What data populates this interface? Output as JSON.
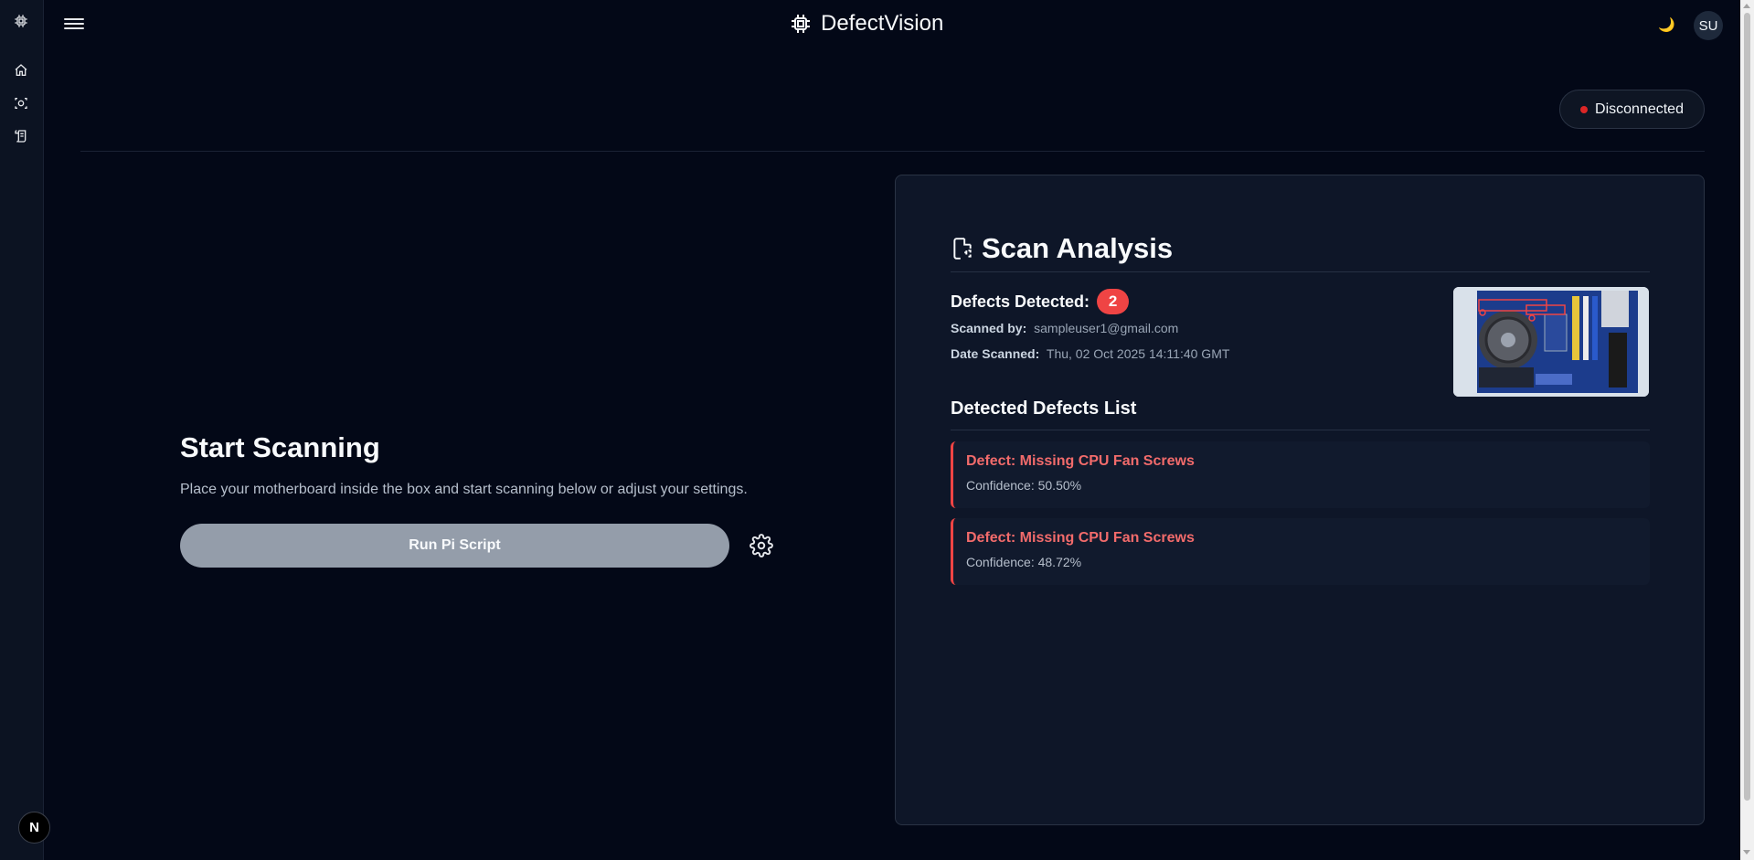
{
  "app": {
    "title": "DefectVision",
    "avatar_initials": "SU",
    "theme_icon": "moon-icon"
  },
  "sidebar": {
    "items": [
      {
        "name": "logo",
        "icon": "chip-icon"
      },
      {
        "name": "home",
        "icon": "home-icon"
      },
      {
        "name": "scan",
        "icon": "scan-icon"
      },
      {
        "name": "logs",
        "icon": "scroll-icon"
      }
    ],
    "footer_badge": "N"
  },
  "connection": {
    "status": "Disconnected",
    "color": "#dc2626"
  },
  "scanner": {
    "title": "Start Scanning",
    "description": "Place your motherboard inside the box and start scanning below or adjust your settings.",
    "run_label": "Run Pi Script"
  },
  "analysis": {
    "title": "Scan Analysis",
    "defects_label": "Defects Detected:",
    "defects_count": "2",
    "scanned_by_label": "Scanned by:",
    "scanned_by": "sampleuser1@gmail.com",
    "date_label": "Date Scanned:",
    "date": "Thu, 02 Oct 2025 14:11:40 GMT",
    "list_title": "Detected Defects List",
    "defects": [
      {
        "name": "Defect: Missing CPU Fan Screws",
        "confidence": "Confidence: 50.50%"
      },
      {
        "name": "Defect: Missing CPU Fan Screws",
        "confidence": "Confidence: 48.72%"
      }
    ]
  },
  "colors": {
    "background": "#030817",
    "panel": "#0e1628",
    "accent_red": "#ef4444",
    "button_gray": "#949daa"
  }
}
